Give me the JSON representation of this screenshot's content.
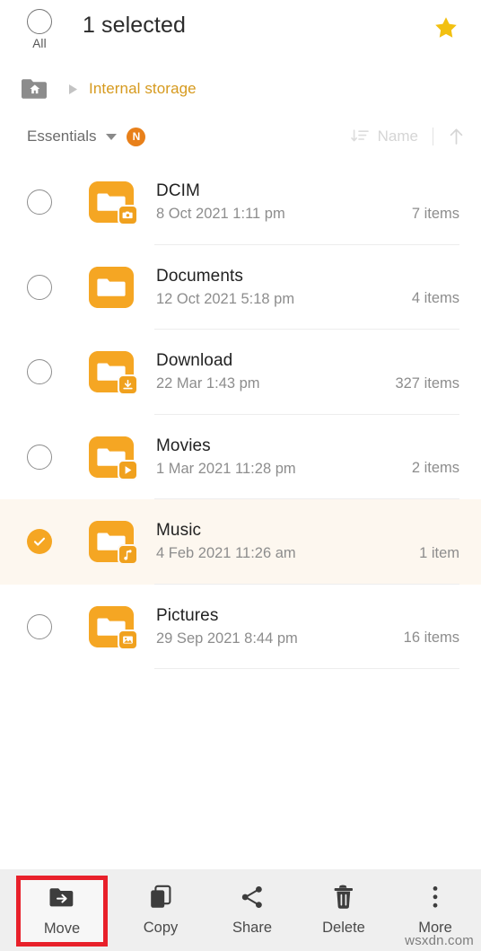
{
  "header": {
    "select_all_label": "All",
    "title": "1 selected",
    "star_icon": "star-icon"
  },
  "breadcrumb": {
    "home_icon": "home-folder-icon",
    "separator_icon": "triangle-right-icon",
    "path_label": "Internal storage"
  },
  "filterbar": {
    "filter_label": "Essentials",
    "caret_icon": "chevron-down-icon",
    "badge_label": "N",
    "sort_icon": "sort-icon",
    "sort_label": "Name",
    "order_icon": "arrow-up-icon"
  },
  "colors": {
    "accent_orange": "#f5a623",
    "folder_orange": "#f5a623",
    "breadcrumb_text": "#d69a1e",
    "badge_orange": "#e8801a",
    "star_gold": "#f2c011",
    "selected_row_bg": "#fdf7ef",
    "toolbar_bg": "#efefef",
    "highlight_box": "#e8202a"
  },
  "files": [
    {
      "name": "DCIM",
      "date": "8 Oct 2021 1:11 pm",
      "count": "7 items",
      "selected": false,
      "badge": "camera-icon"
    },
    {
      "name": "Documents",
      "date": "12 Oct 2021 5:18 pm",
      "count": "4 items",
      "selected": false,
      "badge": "none"
    },
    {
      "name": "Download",
      "date": "22 Mar 1:43 pm",
      "count": "327 items",
      "selected": false,
      "badge": "download-icon"
    },
    {
      "name": "Movies",
      "date": "1 Mar 2021 11:28 pm",
      "count": "2 items",
      "selected": false,
      "badge": "play-icon"
    },
    {
      "name": "Music",
      "date": "4 Feb 2021 11:26 am",
      "count": "1 item",
      "selected": true,
      "badge": "music-note-icon"
    },
    {
      "name": "Pictures",
      "date": "29 Sep 2021 8:44 pm",
      "count": "16 items",
      "selected": false,
      "badge": "image-icon"
    }
  ],
  "toolbar": {
    "items": [
      {
        "label": "Move",
        "icon": "move-folder-icon",
        "highlighted": true
      },
      {
        "label": "Copy",
        "icon": "copy-icon",
        "highlighted": false
      },
      {
        "label": "Share",
        "icon": "share-icon",
        "highlighted": false
      },
      {
        "label": "Delete",
        "icon": "trash-icon",
        "highlighted": false
      },
      {
        "label": "More",
        "icon": "more-vertical-icon",
        "highlighted": false
      }
    ]
  },
  "watermark": "wsxdn.com"
}
